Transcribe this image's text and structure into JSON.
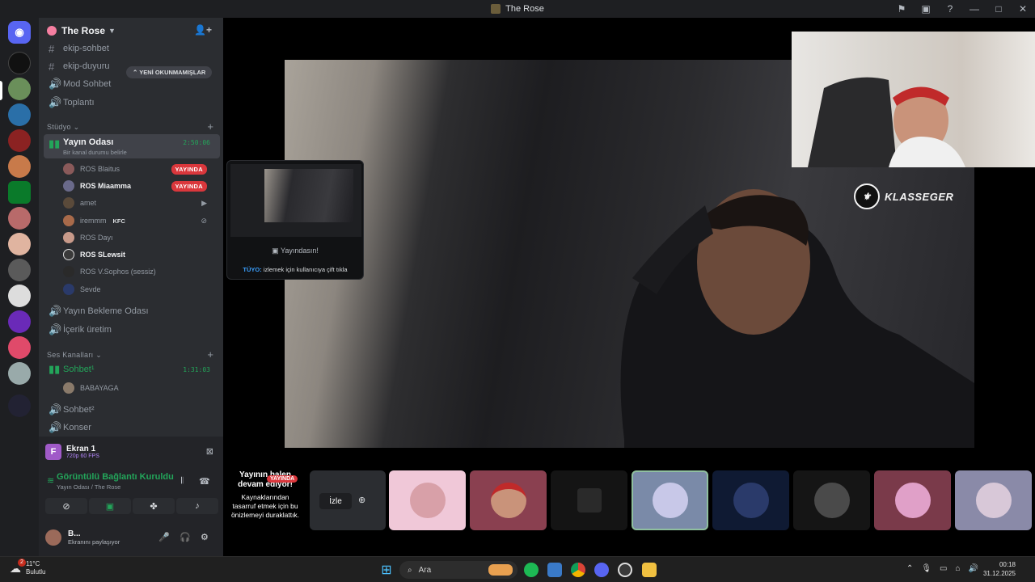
{
  "window": {
    "title": "The Rose"
  },
  "server": {
    "name": "The Rose",
    "unread_pill": "YENİ OKUNMAMIŞLAR"
  },
  "channels": {
    "text": [
      {
        "name": "ekip-sohbet",
        "prefix": "#"
      },
      {
        "name": "ekip-duyuru",
        "prefix": "#"
      },
      {
        "name": "Mod Sohbet",
        "prefix": "🔊"
      },
      {
        "name": "Toplantı",
        "prefix": "🔊"
      }
    ],
    "studio_category": "Stüdyo",
    "stream_room": {
      "name": "Yayın Odası",
      "status": "Bir kanal durumu belirle",
      "timer": "2:50:06"
    },
    "stream_users": [
      {
        "name": "ROS Blaitus",
        "live": "YAYINDA"
      },
      {
        "name": "ROS Miaamma",
        "live": "YAYINDA"
      },
      {
        "name": "amet"
      },
      {
        "name": "iremmm",
        "tag": "KFC"
      },
      {
        "name": "ROS Dayı"
      },
      {
        "name": "ROS SLewsit"
      },
      {
        "name": "ROS V.Sophos (sessiz)"
      },
      {
        "name": "Sevde"
      }
    ],
    "more": [
      {
        "name": "Yayın Bekleme Odası"
      },
      {
        "name": "İçerik üretim"
      }
    ],
    "voice_category": "Ses Kanalları",
    "sohbet1": {
      "name": "Sohbet¹",
      "timer": "1:31:03",
      "users": [
        "BABAYAGA"
      ]
    },
    "sohbet2": "Sohbet²",
    "konser": "Konser"
  },
  "voice_panel": {
    "screen_title": "Ekran 1",
    "screen_sub": "720p 60 FPS",
    "connected": "Görüntülü Bağlantı Kuruldu",
    "connected_sub": "Yayın Odası / The Rose",
    "account_name": "B...",
    "account_status": "Ekranını paylaşıyor"
  },
  "tooltip": {
    "line1": "Yayındasın!",
    "tip_label": "TÜYO:",
    "tip_text": "izlemek için kullanıcıya çift tıkla"
  },
  "watermark": "KLASSEGER",
  "strip": {
    "headline": "Yayının halen devam ediyor!",
    "body": "Kaynaklarından tasarruf etmek için bu önizlemeyi duraklattık.",
    "live": "YAYINDA",
    "watch": "İzle"
  },
  "taskbar": {
    "weather_temp": "11°C",
    "weather_desc": "Bulutlu",
    "search": "Ara",
    "time": "00:18",
    "date": "31.12.2025",
    "badge": "2"
  }
}
